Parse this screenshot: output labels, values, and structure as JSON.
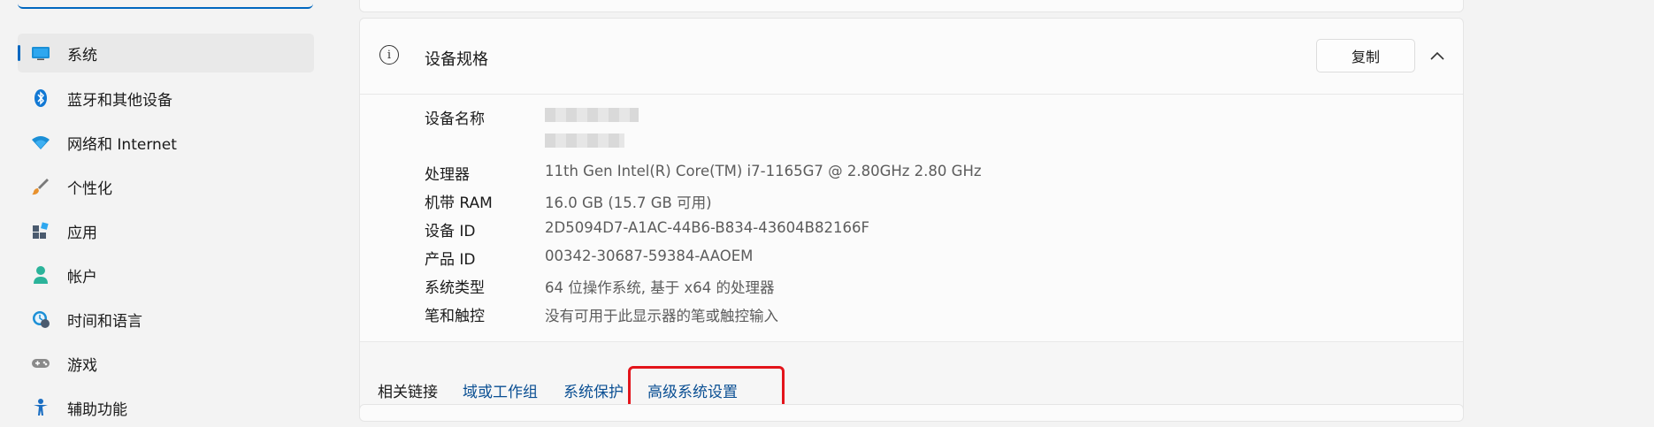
{
  "sidebar": {
    "items": [
      {
        "label": "系统",
        "icon": "monitor-icon",
        "active": true
      },
      {
        "label": "蓝牙和其他设备",
        "icon": "bluetooth-icon"
      },
      {
        "label": "网络和 Internet",
        "icon": "wifi-icon"
      },
      {
        "label": "个性化",
        "icon": "paintbrush-icon"
      },
      {
        "label": "应用",
        "icon": "apps-icon"
      },
      {
        "label": "帐户",
        "icon": "account-icon"
      },
      {
        "label": "时间和语言",
        "icon": "time-language-icon"
      },
      {
        "label": "游戏",
        "icon": "gamepad-icon"
      },
      {
        "label": "辅助功能",
        "icon": "accessibility-icon"
      }
    ]
  },
  "specs": {
    "title": "设备规格",
    "copy_label": "复制",
    "rows": [
      {
        "label": "设备名称",
        "value": ""
      },
      {
        "label": "处理器",
        "value": "11th Gen Intel(R) Core(TM) i7-1165G7 @ 2.80GHz   2.80 GHz"
      },
      {
        "label": "机带 RAM",
        "value": "16.0 GB (15.7 GB 可用)"
      },
      {
        "label": "设备 ID",
        "value": "2D5094D7-A1AC-44B6-B834-43604B82166F"
      },
      {
        "label": "产品 ID",
        "value": "00342-30687-59384-AAOEM"
      },
      {
        "label": "系统类型",
        "value": "64 位操作系统, 基于 x64 的处理器"
      },
      {
        "label": "笔和触控",
        "value": "没有可用于此显示器的笔或触控输入"
      }
    ]
  },
  "related": {
    "label": "相关链接",
    "links": [
      "域或工作组",
      "系统保护",
      "高级系统设置"
    ]
  },
  "colors": {
    "accent": "#0067c0",
    "link": "#0a4f93",
    "highlight": "#e3141b"
  }
}
